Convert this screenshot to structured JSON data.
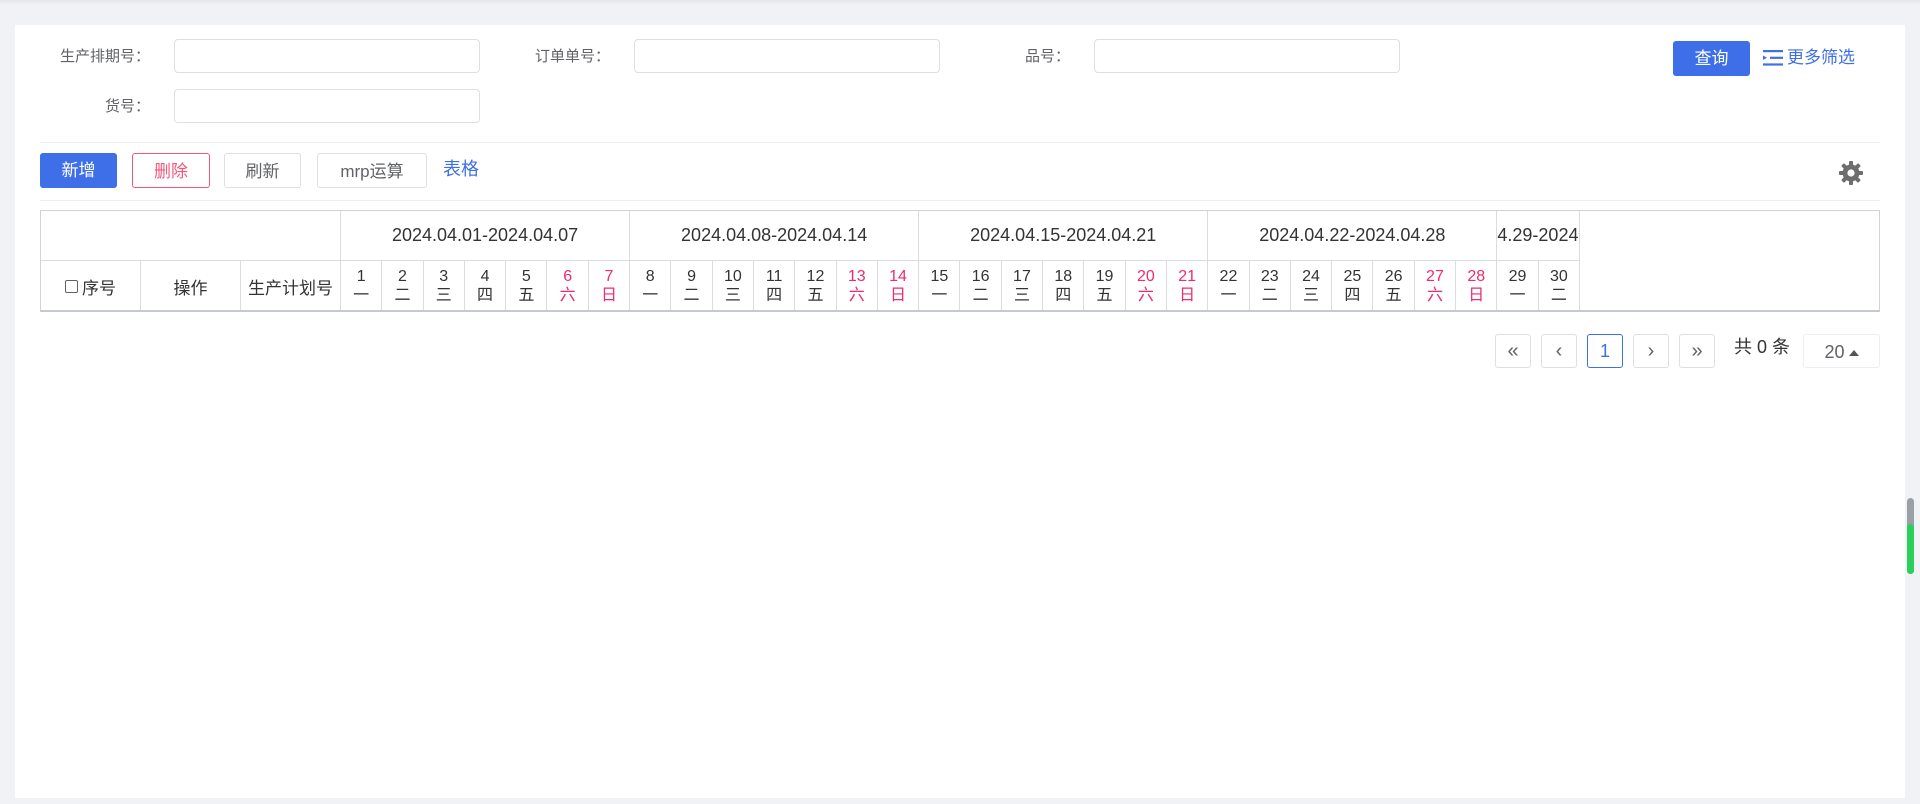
{
  "filters": {
    "schedule_no_label": "生产排期号：",
    "order_no_label": "订单单号：",
    "part_no_label": "品号：",
    "goods_no_label": "货号：",
    "query_label": "查询",
    "more_label": "更多筛选"
  },
  "toolbar": {
    "add_label": "新增",
    "delete_label": "删除",
    "refresh_label": "刷新",
    "mrp_label": "mrp运算",
    "table_label": "表格"
  },
  "table": {
    "col_seq": "序号",
    "col_op": "操作",
    "col_plan": "生产计划号",
    "weeks": [
      "2024.04.01-2024.04.07",
      "2024.04.08-2024.04.14",
      "2024.04.15-2024.04.21",
      "2024.04.22-2024.04.28",
      "4.29-2024"
    ],
    "days": [
      {
        "d": "1",
        "w": "一"
      },
      {
        "d": "2",
        "w": "二"
      },
      {
        "d": "3",
        "w": "三"
      },
      {
        "d": "4",
        "w": "四"
      },
      {
        "d": "5",
        "w": "五"
      },
      {
        "d": "6",
        "w": "六"
      },
      {
        "d": "7",
        "w": "日"
      },
      {
        "d": "8",
        "w": "一"
      },
      {
        "d": "9",
        "w": "二"
      },
      {
        "d": "10",
        "w": "三"
      },
      {
        "d": "11",
        "w": "四"
      },
      {
        "d": "12",
        "w": "五"
      },
      {
        "d": "13",
        "w": "六"
      },
      {
        "d": "14",
        "w": "日"
      },
      {
        "d": "15",
        "w": "一"
      },
      {
        "d": "16",
        "w": "二"
      },
      {
        "d": "17",
        "w": "三"
      },
      {
        "d": "18",
        "w": "四"
      },
      {
        "d": "19",
        "w": "五"
      },
      {
        "d": "20",
        "w": "六"
      },
      {
        "d": "21",
        "w": "日"
      },
      {
        "d": "22",
        "w": "一"
      },
      {
        "d": "23",
        "w": "二"
      },
      {
        "d": "24",
        "w": "三"
      },
      {
        "d": "25",
        "w": "四"
      },
      {
        "d": "26",
        "w": "五"
      },
      {
        "d": "27",
        "w": "六"
      },
      {
        "d": "28",
        "w": "日"
      },
      {
        "d": "29",
        "w": "一"
      },
      {
        "d": "30",
        "w": "二"
      }
    ],
    "weekend_color": "#f02a6e"
  },
  "pagination": {
    "first": "«",
    "prev": "‹",
    "current": "1",
    "next": "›",
    "last": "»",
    "total": "共 0 条",
    "page_size": "20"
  },
  "colors": {
    "primary": "#3f6fe8",
    "danger": "#f5577b"
  }
}
